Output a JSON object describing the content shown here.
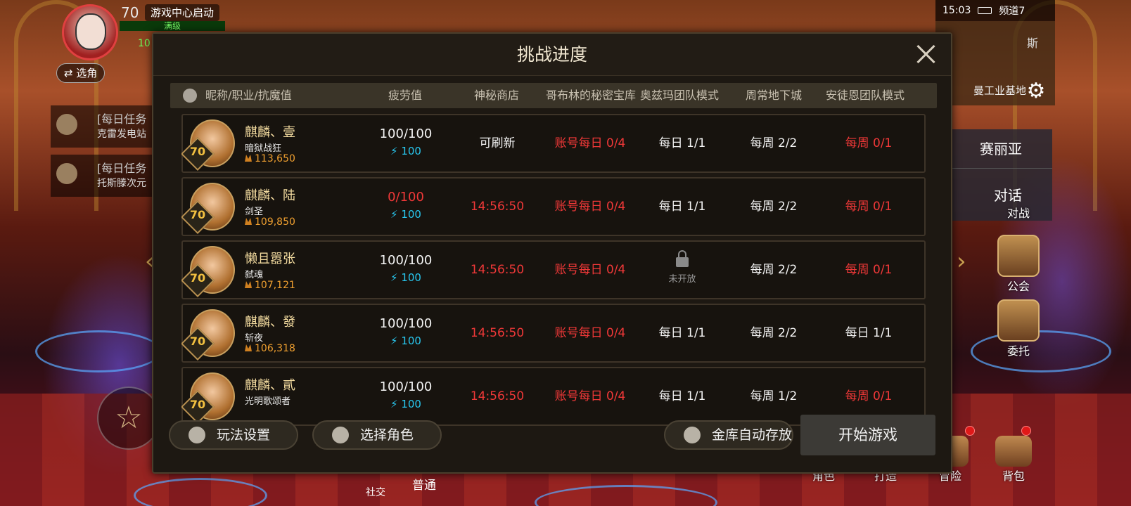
{
  "hud": {
    "level": "70",
    "launch_label": "游戏中心启动",
    "full_label": "满级",
    "num_partial": "10",
    "switch_label": "⇄ 选角"
  },
  "quests": [
    {
      "title": "[每日任务",
      "sub": "克雷发电站"
    },
    {
      "title": "[每日任务",
      "sub": "托斯滕次元"
    }
  ],
  "status": {
    "time": "15:03",
    "channel": "频道7",
    "map_label": "曼工业基地",
    "map_char": "斯"
  },
  "npc": {
    "name": "赛丽亚",
    "talk": "对话"
  },
  "side_buttons": [
    {
      "label": "对战"
    },
    {
      "label": "公会"
    },
    {
      "label": "委托"
    }
  ],
  "bottom_buttons": [
    {
      "label": "角色"
    },
    {
      "label": "打造"
    },
    {
      "label": "冒险"
    },
    {
      "label": "背包"
    }
  ],
  "chat": {
    "tab": "普通",
    "social": "社交"
  },
  "modal": {
    "title": "挑战进度",
    "columns": {
      "name": "昵称/职业/抗魔值",
      "fatigue": "疲劳值",
      "shop": "神秘商店",
      "goblin": "哥布林的秘密宝库",
      "ozma": "奥兹玛团队模式",
      "weekly": "周常地下城",
      "antoine": "安徒恩团队模式"
    },
    "rows": [
      {
        "level": "70",
        "name": "麒麟、壹",
        "job": "暗狱战狂",
        "power": "113,650",
        "fatigue": "100/100",
        "fatigue_sub": "⚡ 100",
        "shop": "可刷新",
        "goblin": "账号每日 0/4",
        "ozma": "每日 1/1",
        "weekly": "每周 2/2",
        "antoine": "每周 0/1"
      },
      {
        "level": "70",
        "name": "麒麟、陆",
        "job": "剑圣",
        "power": "109,850",
        "fatigue": "0/100",
        "fatigue_sub": "⚡ 100",
        "shop": "14:56:50",
        "goblin": "账号每日 0/4",
        "ozma": "每日 1/1",
        "weekly": "每周 2/2",
        "antoine": "每周 0/1"
      },
      {
        "level": "70",
        "name": "懒且嚣张",
        "job": "弑魂",
        "power": "107,121",
        "fatigue": "100/100",
        "fatigue_sub": "⚡ 100",
        "shop": "14:56:50",
        "goblin": "账号每日 0/4",
        "ozma": "未开放",
        "weekly": "每周 2/2",
        "antoine": "每周 0/1"
      },
      {
        "level": "70",
        "name": "麒麟、發",
        "job": "斩夜",
        "power": "106,318",
        "fatigue": "100/100",
        "fatigue_sub": "⚡ 100",
        "shop": "14:56:50",
        "goblin": "账号每日 0/4",
        "ozma": "每日 1/1",
        "weekly": "每周 2/2",
        "antoine": "每日 1/1"
      },
      {
        "level": "70",
        "name": "麒麟、貳",
        "job": "光明歌颂者",
        "power": "",
        "fatigue": "100/100",
        "fatigue_sub": "⚡ 100",
        "shop": "14:56:50",
        "goblin": "账号每日 0/4",
        "ozma": "每日 1/1",
        "weekly": "每周 1/2",
        "antoine": "每周 0/1"
      }
    ],
    "footer": {
      "settings": "玩法设置",
      "select_role": "选择角色",
      "vault_auto": "金库自动存放",
      "start": "开始游戏"
    }
  },
  "colors": {
    "red_value": "#f03838",
    "cyan_value": "#28c8f0",
    "name_gold": "#f4dca0",
    "power_orange": "#f0a030"
  }
}
